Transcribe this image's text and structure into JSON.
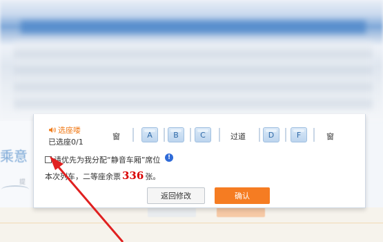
{
  "seat_panel": {
    "header_label": "选座喽",
    "selected_count": "已选座0/1",
    "window_left": "窗",
    "aisle": "过道",
    "window_right": "窗",
    "seats": [
      "A",
      "B",
      "C",
      "D",
      "F"
    ]
  },
  "preference": {
    "checkbox_label": "请优先为我分配“静音车厢”席位",
    "info_symbol": "!"
  },
  "remaining": {
    "prefix": "本次列车，二等座余票",
    "count": "336",
    "suffix": "张。"
  },
  "buttons": {
    "back_label": "返回修改",
    "confirm_label": "确认"
  },
  "background": {
    "left_text": "乘意",
    "left_small": "提"
  },
  "colors": {
    "accent_orange": "#f57c22",
    "count_red": "#d90000",
    "arrow_red": "#e02020",
    "seat_blue": "#bdd5ee"
  }
}
